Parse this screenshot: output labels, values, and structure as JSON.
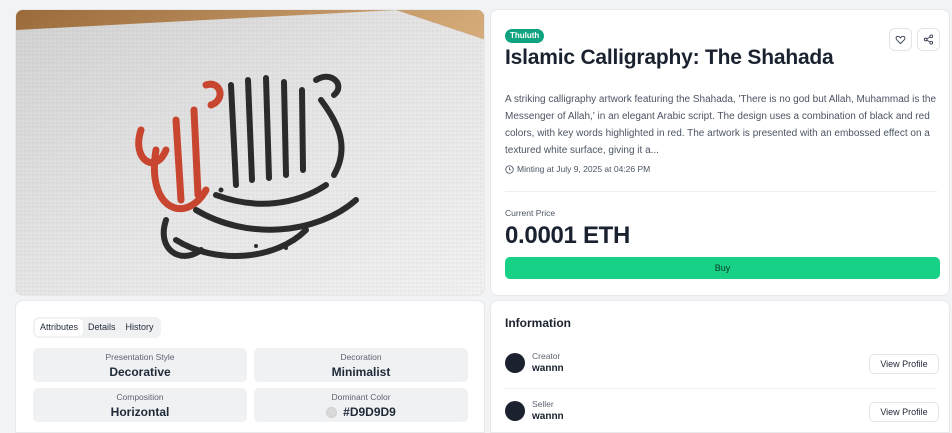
{
  "product": {
    "tag": "Thuluth",
    "title": "Islamic Calligraphy: The Shahada",
    "description": "A striking calligraphy artwork featuring the Shahada, 'There is no god but Allah, Muhammad is the Messenger of Allah,' in an elegant Arabic script. The design uses a combination of black and red colors, with key words highlighted in red. The artwork is presented with an embossed effect on a textured white surface, giving it a...",
    "minting": "Minting at July 9, 2025 at 04:26 PM",
    "price_label": "Current Price",
    "price": "0.0001 ETH",
    "buy_label": "Buy"
  },
  "icons": {
    "favorite": "heart-icon",
    "share": "share-icon",
    "clock": "clock-icon"
  },
  "attributes": {
    "tabs": [
      "Attributes",
      "Details",
      "History"
    ],
    "items": [
      {
        "name": "Presentation Style",
        "value": "Decorative"
      },
      {
        "name": "Decoration",
        "value": "Minimalist"
      },
      {
        "name": "Composition",
        "value": "Horizontal"
      },
      {
        "name": "Dominant Color",
        "value": "#D9D9D9"
      }
    ]
  },
  "information": {
    "title": "Information",
    "people": [
      {
        "role": "Creator",
        "name": "wannn",
        "button": "View Profile"
      },
      {
        "role": "Seller",
        "name": "wannn",
        "button": "View Profile"
      }
    ]
  },
  "colors": {
    "accent": "#17d186",
    "tag": "#10a37f",
    "calligraphy_red": "#c8462f",
    "calligraphy_black": "#2b2b2b"
  }
}
